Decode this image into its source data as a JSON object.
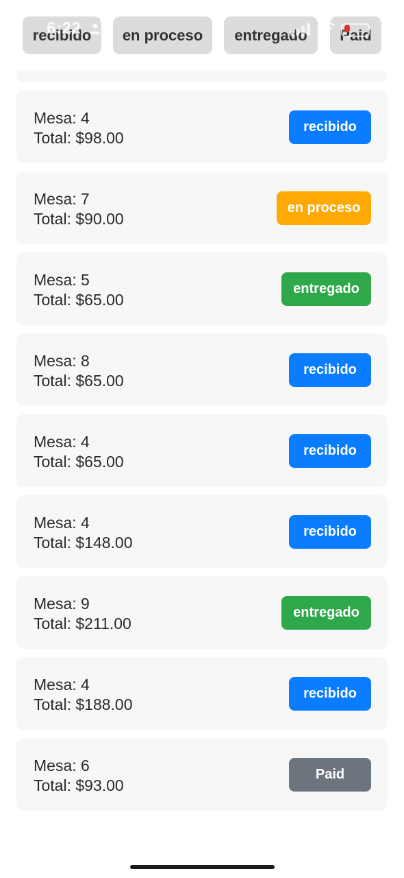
{
  "status_bar": {
    "time": "6:22"
  },
  "filters": {
    "recibido": "recibido",
    "en_proceso": "en proceso",
    "entregado": "entregado",
    "paid": "Paid"
  },
  "orders": [
    {
      "mesa_label": "Mesa: 4",
      "total_label": "Total: $98.00",
      "status": "recibido"
    },
    {
      "mesa_label": "Mesa: 7",
      "total_label": "Total: $90.00",
      "status": "en proceso"
    },
    {
      "mesa_label": "Mesa: 5",
      "total_label": "Total: $65.00",
      "status": "entregado"
    },
    {
      "mesa_label": "Mesa: 8",
      "total_label": "Total: $65.00",
      "status": "recibido"
    },
    {
      "mesa_label": "Mesa: 4",
      "total_label": "Total: $65.00",
      "status": "recibido"
    },
    {
      "mesa_label": "Mesa: 4",
      "total_label": "Total: $148.00",
      "status": "recibido"
    },
    {
      "mesa_label": "Mesa: 9",
      "total_label": "Total: $211.00",
      "status": "entregado"
    },
    {
      "mesa_label": "Mesa: 4",
      "total_label": "Total: $188.00",
      "status": "recibido"
    },
    {
      "mesa_label": "Mesa: 6",
      "total_label": "Total: $93.00",
      "status": "Paid"
    }
  ],
  "colors": {
    "recibido": "#0a7cff",
    "en_proceso": "#ffa905",
    "entregado": "#2ea84b",
    "paid": "#6c757d",
    "pill_bg": "#dcdcdc",
    "card_bg": "#f7f7f7"
  }
}
